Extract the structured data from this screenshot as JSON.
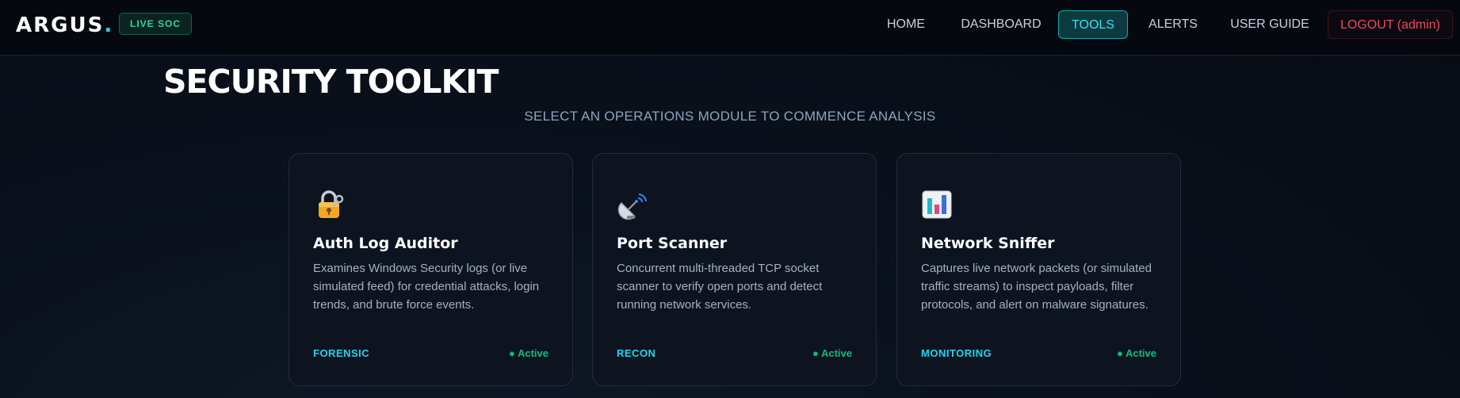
{
  "brand": {
    "name": "ARGUS",
    "dot": ".",
    "badge": "LIVE SOC"
  },
  "nav": {
    "home": "HOME",
    "dashboard": "DASHBOARD",
    "tools": "TOOLS",
    "alerts": "ALERTS",
    "user_guide": "USER GUIDE",
    "logout": "LOGOUT (admin)",
    "active": "TOOLS"
  },
  "page": {
    "title": "SECURITY TOOLKIT",
    "subtitle": "SELECT AN OPERATIONS MODULE TO COMMENCE ANALYSIS"
  },
  "cards": [
    {
      "icon": "lock-with-key-icon",
      "title": "Auth Log Auditor",
      "description": "Examines Windows Security logs (or live simulated feed) for credential attacks, login trends, and brute force events.",
      "tag": "FORENSIC",
      "status": "● Active"
    },
    {
      "icon": "satellite-dish-icon",
      "title": "Port Scanner",
      "description": "Concurrent multi-threaded TCP socket scanner to verify open ports and detect running network services.",
      "tag": "RECON",
      "status": "● Active"
    },
    {
      "icon": "bar-chart-icon",
      "title": "Network Sniffer",
      "description": "Captures live network packets (or simulated traffic streams) to inspect payloads, filter protocols, and alert on malware signatures.",
      "tag": "MONITORING",
      "status": "● Active"
    }
  ],
  "colors": {
    "accent": "#22d3ee",
    "status_active": "#10b981",
    "logout": "#f0475f",
    "background": "#070b14"
  }
}
